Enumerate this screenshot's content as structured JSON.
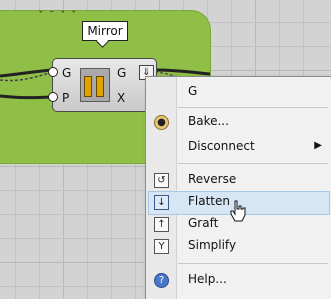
{
  "canvas": {
    "background": "#d3d3d3",
    "grid_color": "#c2c2c2"
  },
  "group": {
    "color": "#8fbf47",
    "cropped_text": "ˇ ˘ ˇ ˇ"
  },
  "tooltip": {
    "label": "Mirror"
  },
  "component": {
    "inputs": [
      "G",
      "P"
    ],
    "outputs": [
      "G",
      "X"
    ],
    "icon": "mirror-icon",
    "accent": "#e2a200"
  },
  "menu": {
    "header": "G",
    "items": [
      {
        "label": "Bake...",
        "icon": "bake-icon"
      },
      {
        "label": "Disconnect",
        "icon": "",
        "submenu": true
      },
      {
        "label": "Reverse",
        "icon": "reverse-icon"
      },
      {
        "label": "Flatten",
        "icon": "flatten-icon",
        "checked": true
      },
      {
        "label": "Graft",
        "icon": "graft-icon"
      },
      {
        "label": "Simplify",
        "icon": "simplify-icon"
      },
      {
        "label": "Help...",
        "icon": "help-icon"
      }
    ]
  }
}
